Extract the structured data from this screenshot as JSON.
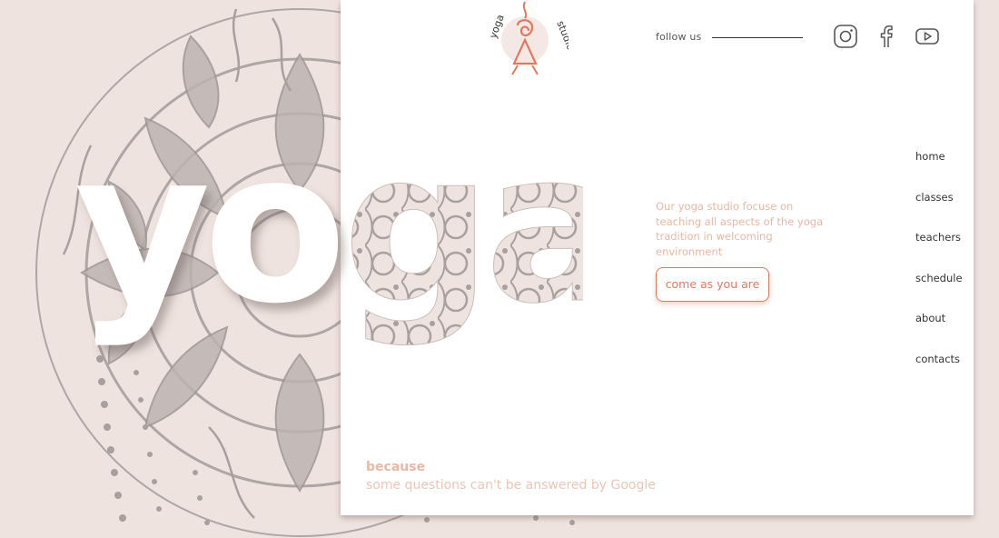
{
  "brand": {
    "logo_word_left": "yoga",
    "logo_word_right": "studio"
  },
  "hero": {
    "word": "yoga",
    "tagline": "Our yoga studio focuse on teaching all aspects of the yoga tradition in welcoming environment",
    "cta_label": "come as you are"
  },
  "social": {
    "follow_label": "follow us",
    "icons": [
      "instagram-icon",
      "facebook-icon",
      "youtube-icon"
    ]
  },
  "nav": {
    "items": [
      {
        "label": "home"
      },
      {
        "label": "classes"
      },
      {
        "label": "teachers"
      },
      {
        "label": "schedule"
      },
      {
        "label": "about"
      },
      {
        "label": "contacts"
      }
    ]
  },
  "footer": {
    "heading": "because",
    "subtext": "some questions can't be answered by Google"
  },
  "colors": {
    "background": "#efe3df",
    "accent": "#e07a5f",
    "soft_accent": "#e8b8a6",
    "mandala_stroke": "#a8a09e"
  }
}
